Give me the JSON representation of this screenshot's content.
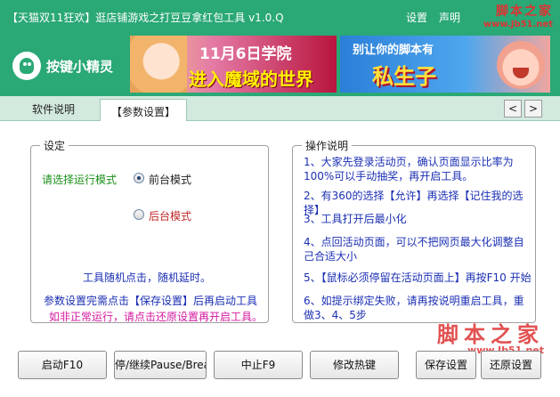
{
  "titlebar": {
    "title": "【天猫双11狂欢】逛店铺游戏之打豆豆拿红包工具 v1.0.Q",
    "settings_label": "设置",
    "statement_label": "声明",
    "watermark_name": "脚本之家",
    "watermark_url": "www.Jb51.net"
  },
  "brand": {
    "app_name": "按键小精灵"
  },
  "banners": {
    "left": {
      "line1": "11月6日学院",
      "line2": "进入魔域的世界"
    },
    "right": {
      "line1": "别让你的脚本有",
      "line2": "私生子"
    }
  },
  "tabs": [
    {
      "label": "软件说明"
    },
    {
      "label": "【参数设置】"
    }
  ],
  "nav": {
    "prev": "<",
    "next": ">"
  },
  "settings_group": {
    "legend": "设定",
    "mode_label": "请选择运行模式",
    "option_foreground": "前台模式",
    "option_background": "后台模式",
    "selected": "前台模式",
    "note_random": "工具随机点击，随机延时。",
    "note_save": "参数设置完需点击【保存设置】后再启动工具",
    "note_restore": "如非正常运行，请点击还原设置再开启工具。"
  },
  "instructions_group": {
    "legend": "操作说明",
    "steps": [
      "1、大家先登录活动页，确认页面显示比率为100%可以手动抽奖，再开启工具。",
      "2、有360的选择【允许】再选择【记住我的选择】",
      "3、工具打开后最小化",
      "4、点回活动页面，可以不把网页最大化调整自己合适大小",
      "5、【鼠标必须停留在活动页面上】再按F10 开始",
      "6、如提示绑定失败，请再按说明重启工具，重做3、4、5步"
    ]
  },
  "buttons": {
    "start": "启动F10",
    "pause": "停/继续Pause/Brea",
    "stop": "中止F9",
    "hotkey": "修改热键",
    "save": "保存设置",
    "restore": "还原设置"
  },
  "colors": {
    "brand_green": "#2aa876",
    "instruction_blue": "#1b2fb3",
    "warning_magenta": "#d4189f",
    "watermark_red": "#d33"
  }
}
